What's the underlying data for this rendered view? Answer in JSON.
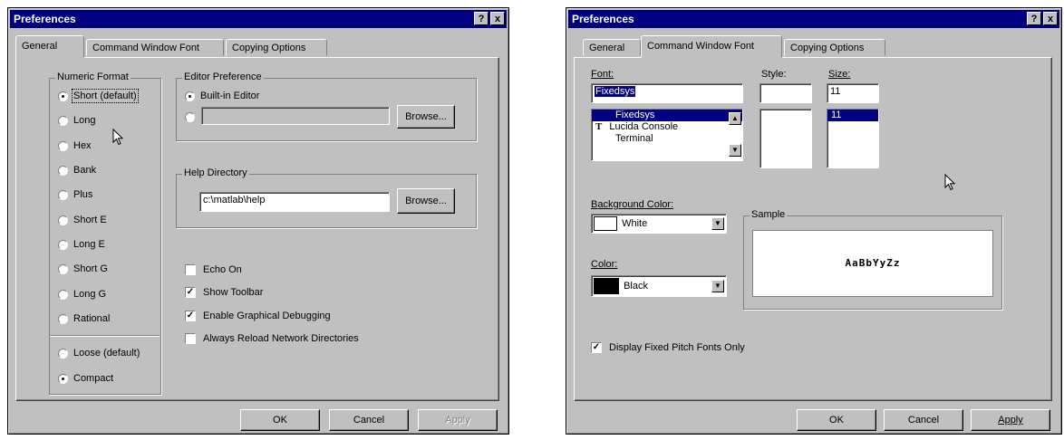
{
  "left": {
    "title": "Preferences",
    "help_btn": "?",
    "close_btn": "x",
    "tabs": [
      "General",
      "Command Window Font",
      "Copying Options"
    ],
    "numeric_format": {
      "label": "Numeric Format",
      "options": [
        "Short (default)",
        "Long",
        "Hex",
        "Bank",
        "Plus",
        "Short E",
        "Long E",
        "Short G",
        "Long G",
        "Rational"
      ],
      "selected": "Short (default)",
      "spacing": [
        "Loose (default)",
        "Compact"
      ],
      "spacing_selected": "Compact"
    },
    "editor": {
      "label": "Editor Preference",
      "builtin": "Built-in Editor",
      "custom_value": "",
      "browse": "Browse..."
    },
    "help_dir": {
      "label": "Help Directory",
      "value": "c:\\matlab\\help",
      "browse": "Browse..."
    },
    "checks": [
      {
        "label": "Echo On",
        "checked": false
      },
      {
        "label": "Show Toolbar",
        "checked": true
      },
      {
        "label": "Enable Graphical Debugging",
        "checked": true
      },
      {
        "label": "Always Reload Network Directories",
        "checked": false
      }
    ],
    "buttons": {
      "ok": "OK",
      "cancel": "Cancel",
      "apply": "Apply"
    }
  },
  "right": {
    "title": "Preferences",
    "help_btn": "?",
    "close_btn": "x",
    "tabs": [
      "General",
      "Command Window Font",
      "Copying Options"
    ],
    "font_label": "Font:",
    "font_value": "Fixedsys",
    "font_list": [
      "Fixedsys",
      "Lucida Console",
      "Terminal"
    ],
    "tt_icon": "T",
    "style_label": "Style:",
    "style_value": "",
    "size_label": "Size:",
    "size_value": "11",
    "size_list": [
      "11"
    ],
    "bg_color_label": "Background Color:",
    "bg_color_value": "White",
    "bg_swatch": "#ffffff",
    "color_label": "Color:",
    "color_value": "Black",
    "color_swatch": "#000000",
    "sample_label": "Sample",
    "sample_text": "AaBbYyZz",
    "fixed_pitch": "Display Fixed Pitch Fonts Only",
    "fixed_pitch_checked": true,
    "buttons": {
      "ok": "OK",
      "cancel": "Cancel",
      "apply": "Apply"
    }
  }
}
